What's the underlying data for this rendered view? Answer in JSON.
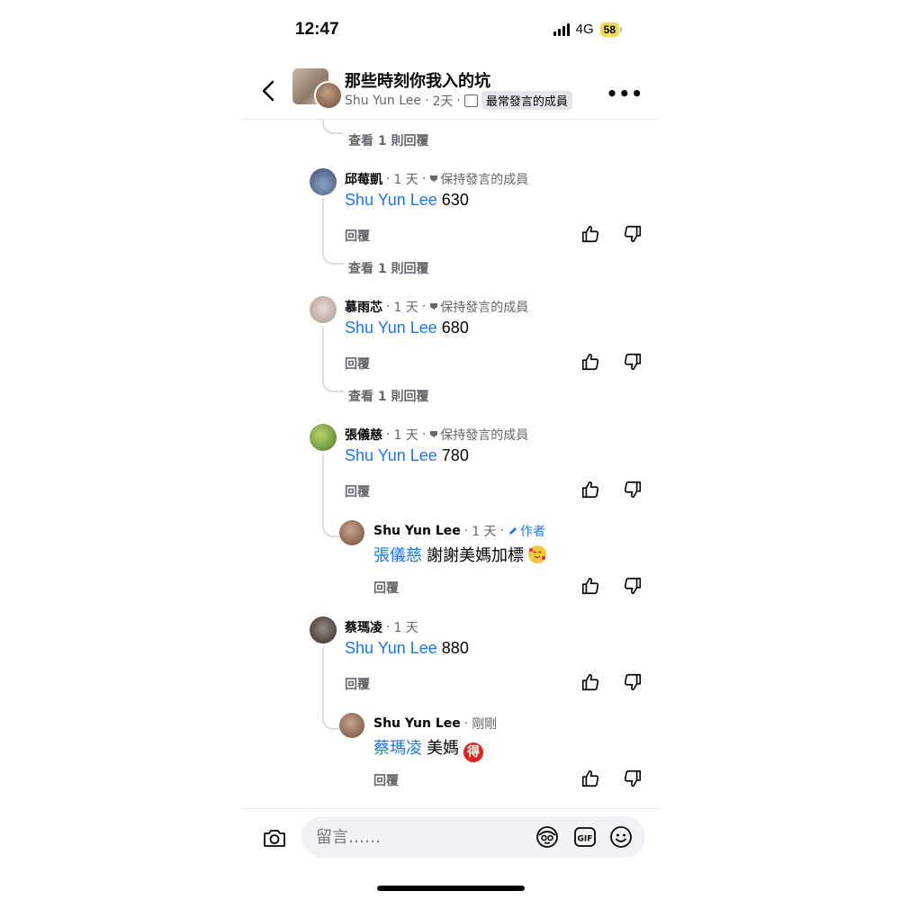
{
  "status_bar": {
    "time": "12:47",
    "network": "4G",
    "battery": "58"
  },
  "header": {
    "title": "那些時刻你我入的坑",
    "author": "Shu Yun Lee",
    "age": "2天",
    "badge": "最常發言的成員"
  },
  "comments": [
    {
      "view_replies": "查看 1 則回覆"
    },
    {
      "name": "邱莓凱",
      "age": "1 天",
      "badge": "保持發言的成員",
      "mention": "Shu Yun Lee",
      "text": "630",
      "reply": "回覆",
      "view_replies": "查看 1 則回覆"
    },
    {
      "name": "慕雨芯",
      "age": "1 天",
      "badge": "保持發言的成員",
      "mention": "Shu Yun Lee",
      "text": "680",
      "reply": "回覆",
      "view_replies": "查看 1 則回覆"
    },
    {
      "name": "張儀慈",
      "age": "1 天",
      "badge": "保持發言的成員",
      "mention": "Shu Yun Lee",
      "text": "780",
      "reply": "回覆",
      "replies": [
        {
          "name": "Shu Yun Lee",
          "age": "1 天",
          "badge": "作者",
          "mention": "張儀慈",
          "text": "謝謝美媽加標",
          "emoji": "smiling-face-with-hearts",
          "reply": "回覆"
        }
      ]
    },
    {
      "name": "蔡瑪凌",
      "age": "1 天",
      "mention": "Shu Yun Lee",
      "text": "880",
      "reply": "回覆",
      "replies": [
        {
          "name": "Shu Yun Lee",
          "age": "剛剛",
          "mention": "蔡瑪凌",
          "text": "美媽",
          "emoji_text": "得",
          "reply": "回覆"
        }
      ]
    }
  ],
  "composer": {
    "placeholder": "留言……"
  },
  "icons": {
    "back": "chevron-left-icon",
    "more": "more-dots-icon",
    "like": "thumbs-up-icon",
    "dislike": "thumbs-down-icon",
    "camera": "camera-icon",
    "avatar_sticker": "avatar-sticker-icon",
    "gif": "gif-icon",
    "emoji": "smiley-icon",
    "trophy": "trophy-icon",
    "pencil": "pencil-icon"
  },
  "colors": {
    "mention": "#1877f2",
    "secondary_text": "#65676b",
    "battery": "#f7d84a"
  }
}
